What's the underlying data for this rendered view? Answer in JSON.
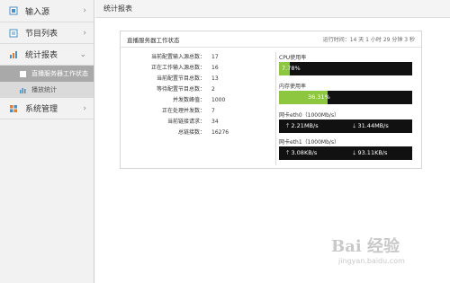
{
  "sidebar": {
    "items": [
      {
        "label": "输入源",
        "icon": "input-source-icon",
        "expanded": false
      },
      {
        "label": "节目列表",
        "icon": "program-list-icon",
        "expanded": false
      },
      {
        "label": "统计报表",
        "icon": "report-icon",
        "expanded": true
      },
      {
        "label": "系统管理",
        "icon": "system-manage-icon",
        "expanded": false
      }
    ],
    "sub_items": [
      {
        "label": "直播服务器工作状态",
        "active": true
      },
      {
        "label": "播放统计",
        "active": false
      }
    ]
  },
  "header": {
    "title": "统计报表"
  },
  "panel": {
    "title": "直播服务器工作状态",
    "uptime": "运行时间：14 天 1 小时 29 分钟 3 秒",
    "stats": [
      {
        "label": "当前配置输入源总数：",
        "value": "17"
      },
      {
        "label": "正在工作输入源总数：",
        "value": "16"
      },
      {
        "label": "当前配置节目总数：",
        "value": "13"
      },
      {
        "label": "等待配置节目总数：",
        "value": "2"
      },
      {
        "label": "并发数峰值：",
        "value": "1000"
      },
      {
        "label": "正在处理并发数：",
        "value": "7"
      },
      {
        "label": "当前链接请求：",
        "value": "34"
      },
      {
        "label": "总链接数：",
        "value": "16276"
      }
    ],
    "cpu": {
      "label": "CPU使用率",
      "text": "7.78%",
      "percent": 7.78
    },
    "memory": {
      "label": "内存使用率",
      "text": "36.31%",
      "percent": 36.31
    },
    "eth0": {
      "label": "网卡eth0（1000Mb/s）",
      "up": "2.21MB/s",
      "down": "31.44MB/s"
    },
    "eth1": {
      "label": "网卡eth1（1000Mb/s）",
      "up": "3.08KB/s",
      "down": "93.11KB/s"
    }
  },
  "watermark": {
    "brand": "Bai 经验",
    "site": "jingyan.baidu.com"
  },
  "colors": {
    "accent_green": "#8dc63f",
    "bar_dark": "#111111",
    "active_sub": "#a9a9a9"
  }
}
